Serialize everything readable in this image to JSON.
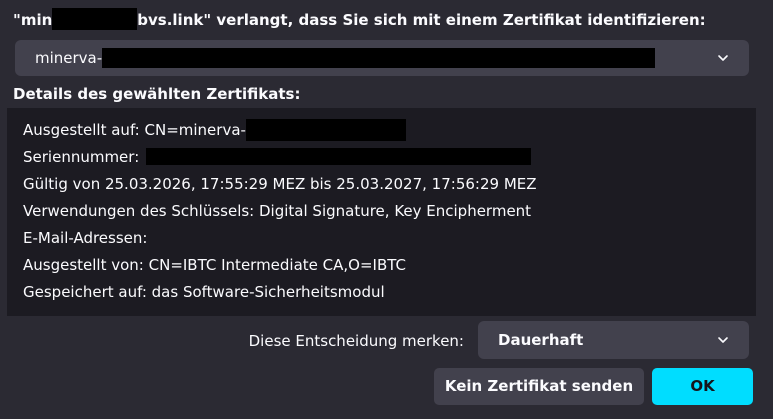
{
  "dialog": {
    "title_prefix": "\"min",
    "title_suffix": "bvs.link\" verlangt, dass Sie sich mit einem Zertifikat identifizieren:",
    "certificate_select": {
      "value_prefix": "minerva-",
      "icon": "chevron-down-icon"
    },
    "details_label": "Details des gewählten Zertifikats:",
    "details": {
      "issued_to_prefix": "Ausgestellt auf: CN=minerva-",
      "serial_prefix": "Seriennummer:",
      "validity": "Gültig von 25.03.2026, 17:55:29 MEZ bis 25.03.2027, 17:56:29 MEZ",
      "key_usage": "Verwendungen des Schlüssels: Digital Signature, Key Encipherment",
      "email": "E-Mail-Adressen:",
      "issued_by": "Ausgestellt von: CN=IBTC Intermediate CA,O=IBTC",
      "stored_on": "Gespeichert auf: das Software-Sicherheitsmodul"
    },
    "remember": {
      "label": "Diese Entscheidung merken:",
      "value": "Dauerhaft",
      "icon": "chevron-down-icon"
    },
    "buttons": {
      "cancel_label": "Kein Zertifikat senden",
      "ok_label": "OK"
    },
    "colors": {
      "background": "#2b2a33",
      "details_background": "#1c1b22",
      "control_background": "#42414d",
      "accent": "#00ddff",
      "text": "#fbfbfe"
    }
  }
}
